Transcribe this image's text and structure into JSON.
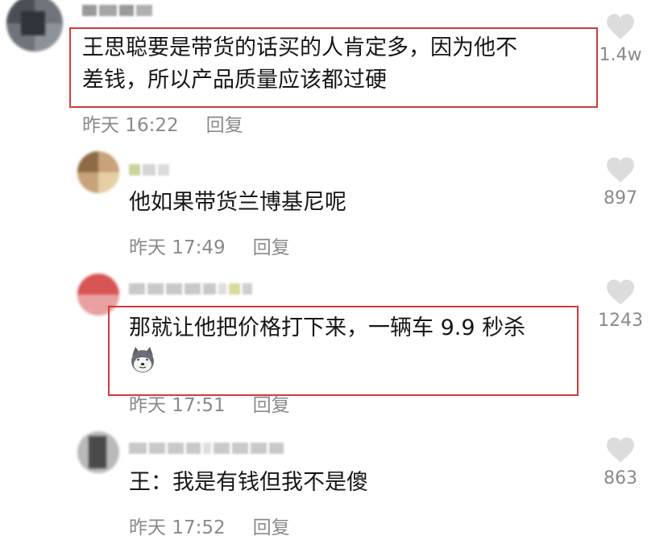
{
  "colors": {
    "highlight_border": "#d43a3a",
    "meta_text": "#8a8a8a",
    "body_text": "#161616",
    "like_icon": "#dcdcdc"
  },
  "comments": [
    {
      "text_lines": [
        "王思聪要是带货的话买的人肯定多，因为他不",
        "差钱，所以产品质量应该都过硬"
      ],
      "time": "昨天 16:22",
      "reply": "回复",
      "likes": "1.4w",
      "highlighted": true,
      "like_icon": "heart-icon"
    },
    {
      "text_lines": [
        "他如果带货兰博基尼呢"
      ],
      "time": "昨天 17:49",
      "reply": "回复",
      "likes": "897",
      "highlighted": false,
      "like_icon": "heart-icon"
    },
    {
      "text_lines": [
        "那就让他把价格打下来，一辆车 9.9 秒杀"
      ],
      "emoji": "husky-dog-emoji",
      "time": "昨天 17:51",
      "reply": "回复",
      "likes": "1243",
      "highlighted": true,
      "like_icon": "heart-icon"
    },
    {
      "text_lines": [
        "王：我是有钱但我不是傻"
      ],
      "time": "昨天 17:52",
      "reply": "回复",
      "likes": "863",
      "highlighted": false,
      "like_icon": "heart-icon"
    }
  ]
}
